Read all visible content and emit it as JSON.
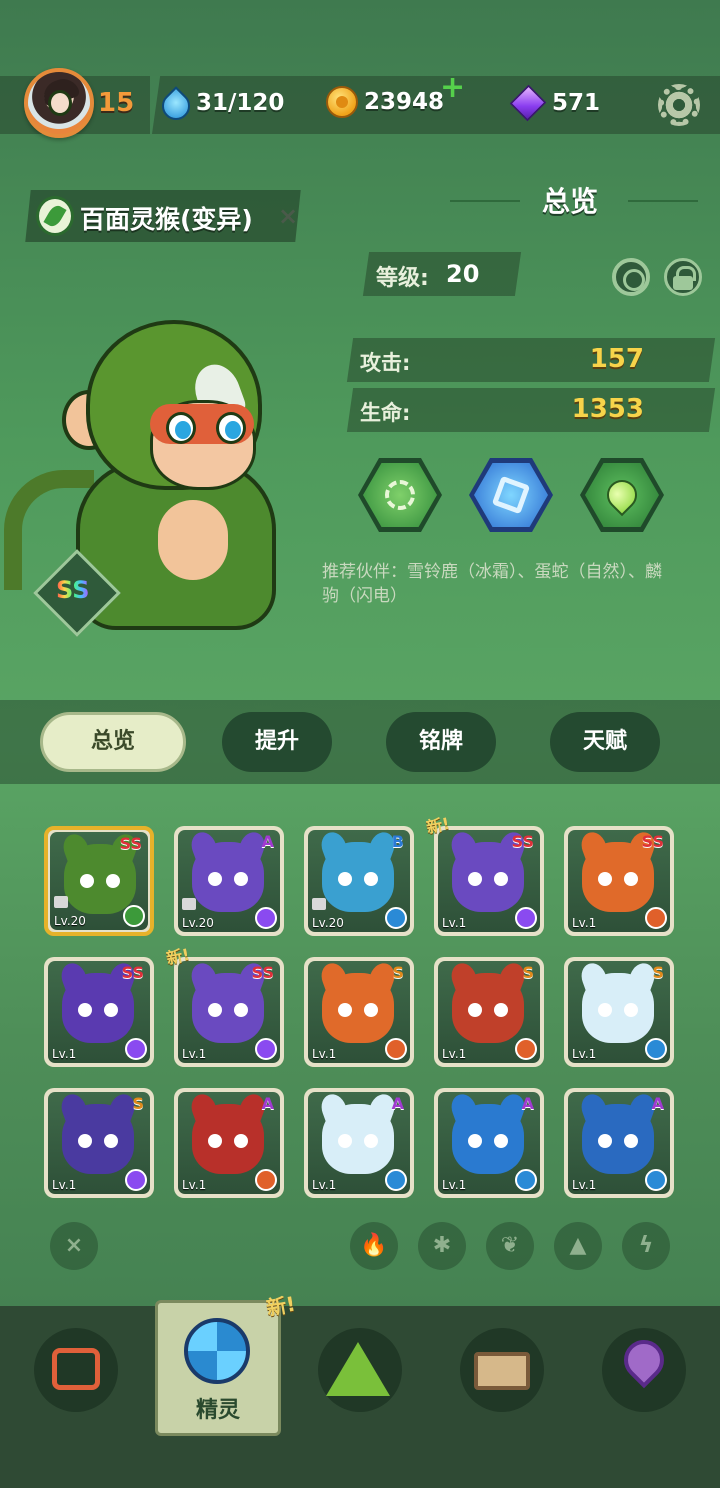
{
  "header": {
    "player_level": "15",
    "stamina": "31/120",
    "coins": "23948",
    "coins_add": "+",
    "gems": "571"
  },
  "pet": {
    "name": "百面灵猴(变异)",
    "grade": "SS",
    "level_label": "等级:",
    "level_value": "20",
    "attack_label": "攻击:",
    "attack_value": "157",
    "hp_label": "生命:",
    "hp_value": "1353",
    "partners": "推荐伙伴：雪铃鹿（冰霜）、蛋蛇（自然）、麟驹（闪电）"
  },
  "overview_title": "总览",
  "close_glyph": "×",
  "tabs": [
    {
      "label": "总览",
      "active": true
    },
    {
      "label": "提升",
      "active": false
    },
    {
      "label": "铭牌",
      "active": false
    },
    {
      "label": "天赋",
      "active": false
    }
  ],
  "pets": [
    {
      "rank": "SS",
      "level": "Lv.20",
      "element": "nature",
      "locked": true,
      "new": false,
      "color": "#4d8a2e"
    },
    {
      "rank": "A",
      "level": "Lv.20",
      "element": "lightning",
      "locked": true,
      "new": false,
      "color": "#6a4ac0"
    },
    {
      "rank": "B",
      "level": "Lv.20",
      "element": "ice",
      "locked": true,
      "new": false,
      "color": "#3aa0d0"
    },
    {
      "rank": "SS",
      "level": "Lv.1",
      "element": "lightning",
      "locked": false,
      "new": true,
      "color": "#6a4ac0"
    },
    {
      "rank": "SS",
      "level": "Lv.1",
      "element": "fire",
      "locked": false,
      "new": false,
      "color": "#e06a2a"
    },
    {
      "rank": "SS",
      "level": "Lv.1",
      "element": "lightning",
      "locked": false,
      "new": false,
      "color": "#5a3ab0"
    },
    {
      "rank": "SS",
      "level": "Lv.1",
      "element": "lightning",
      "locked": false,
      "new": true,
      "color": "#6a4ac0"
    },
    {
      "rank": "S",
      "level": "Lv.1",
      "element": "fire",
      "locked": false,
      "new": false,
      "color": "#e06a2a"
    },
    {
      "rank": "S",
      "level": "Lv.1",
      "element": "fire",
      "locked": false,
      "new": false,
      "color": "#c0402a"
    },
    {
      "rank": "S",
      "level": "Lv.1",
      "element": "ice",
      "locked": false,
      "new": false,
      "color": "#d8eef8"
    },
    {
      "rank": "S",
      "level": "Lv.1",
      "element": "lightning",
      "locked": false,
      "new": false,
      "color": "#4a3aa0"
    },
    {
      "rank": "A",
      "level": "Lv.1",
      "element": "fire",
      "locked": false,
      "new": false,
      "color": "#b8302a"
    },
    {
      "rank": "A",
      "level": "Lv.1",
      "element": "ice",
      "locked": false,
      "new": false,
      "color": "#d8eef8"
    },
    {
      "rank": "A",
      "level": "Lv.1",
      "element": "ice",
      "locked": false,
      "new": false,
      "color": "#2a7ad0"
    },
    {
      "rank": "A",
      "level": "Lv.1",
      "element": "ice",
      "locked": false,
      "new": false,
      "color": "#2a6ac0"
    }
  ],
  "new_tag": "新!",
  "element_colors": {
    "nature": "#3c9a3a",
    "lightning": "#8a4af0",
    "ice": "#2a8ad6",
    "fire": "#e0602a"
  },
  "rank_colors": {
    "SS": "#e0303a",
    "S": "#e08a1a",
    "A": "#a03ad0",
    "B": "#2a7ad6"
  },
  "filters": {
    "clear_glyph": "×",
    "elements": [
      "fire-icon",
      "ice-icon",
      "nature-icon",
      "rock-icon",
      "lightning-icon"
    ]
  },
  "bottom_nav": {
    "items": [
      "battle-icon",
      "spirit-icon",
      "mountain-icon",
      "chest-icon",
      "map-pin-icon"
    ],
    "active_label": "精灵",
    "new_tag": "新!"
  }
}
